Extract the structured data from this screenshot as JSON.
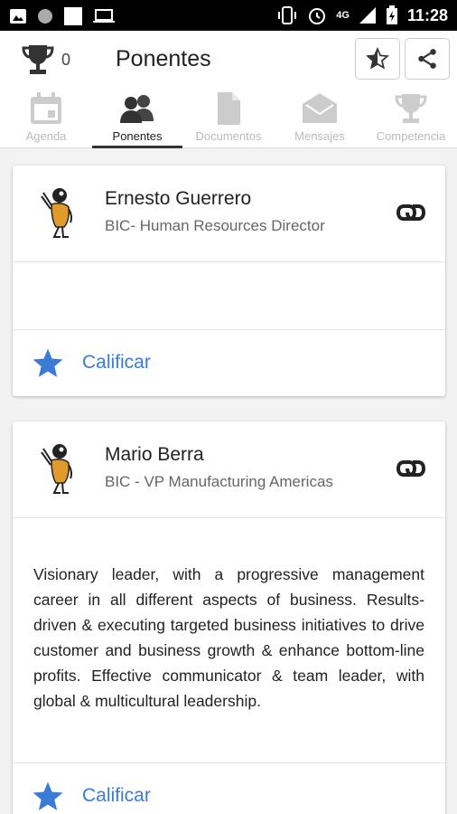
{
  "status_bar": {
    "time": "11:28",
    "network": "4G"
  },
  "app_bar": {
    "score": "0",
    "title": "Ponentes"
  },
  "tabs": [
    {
      "label": "Agenda",
      "icon": "calendar-icon"
    },
    {
      "label": "Ponentes",
      "icon": "people-icon",
      "active": true
    },
    {
      "label": "Documentos",
      "icon": "document-icon"
    },
    {
      "label": "Mensajes",
      "icon": "mail-icon"
    },
    {
      "label": "Competencia",
      "icon": "trophy-icon"
    }
  ],
  "speakers": [
    {
      "name": "Ernesto Guerrero",
      "role": "BIC- Human Resources Director",
      "bio": "",
      "rate_label": "Calificar"
    },
    {
      "name": "Mario Berra",
      "role": "BIC - VP Manufacturing Americas",
      "bio": "Visionary leader, with a progressive management career in all different aspects of business. Results-driven & executing targeted business initiatives to drive customer and business growth & enhance bottom-line profits. Effective communicator & team leader, with global & multicultural leadership.",
      "rate_label": "Calificar"
    }
  ],
  "colors": {
    "accent": "#3a7bd5",
    "active_tab": "#222222",
    "inactive_tab": "#bbbbbb"
  }
}
